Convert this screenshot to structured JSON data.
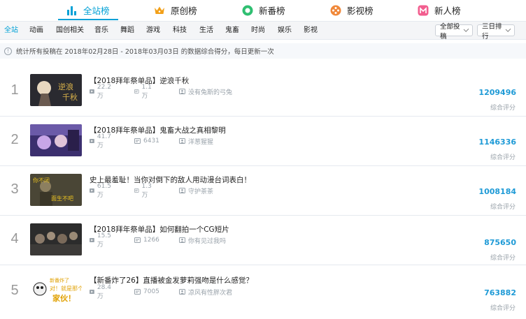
{
  "rank_tabs": [
    {
      "label": "全站榜",
      "icon": "bar-chart-icon",
      "active": true
    },
    {
      "label": "原创榜",
      "icon": "crown-icon",
      "active": false
    },
    {
      "label": "新番榜",
      "icon": "circle-icon",
      "active": false
    },
    {
      "label": "影视榜",
      "icon": "film-reel-icon",
      "active": false
    },
    {
      "label": "新人榜",
      "icon": "new-icon",
      "active": false
    }
  ],
  "categories": [
    "全站",
    "动画",
    "国创相关",
    "音乐",
    "舞蹈",
    "游戏",
    "科技",
    "生活",
    "鬼畜",
    "时尚",
    "娱乐",
    "影视"
  ],
  "filters": {
    "type_select": "全部投稿",
    "period_select": "三日排行"
  },
  "notice": "统计所有投稿在 2018年02月28日 - 2018年03月03日 的数据综合得分，每日更新一次",
  "score_label": "综合评分",
  "items": [
    {
      "rank": "1",
      "title": "【2018拜年祭单品】逆浪千秋",
      "plays": "22.2万",
      "danmaku": "1.1万",
      "uploader": "没有兔斯的弓兔",
      "score": "1209496",
      "thumb_colors": [
        "#2a2a30",
        "#d9b24a"
      ]
    },
    {
      "rank": "2",
      "title": "【2018拜年祭单品】鬼畜大战之真相黎明",
      "plays": "41.7万",
      "danmaku": "6431",
      "uploader": "洋葱猩猩",
      "score": "1146336",
      "thumb_colors": [
        "#3b2f6e",
        "#c8a6e8"
      ]
    },
    {
      "rank": "3",
      "title": "史上最羞耻！当你对倒下的敌人用动漫台词表白！",
      "plays": "61.5万",
      "danmaku": "1.3万",
      "uploader": "守护茶茶",
      "score": "1008184",
      "thumb_colors": [
        "#4a4636",
        "#e8c020"
      ]
    },
    {
      "rank": "4",
      "title": "【2018拜年祭单品】如何翻拍一个CG短片",
      "plays": "15.5万",
      "danmaku": "1266",
      "uploader": "你有见过我吗",
      "score": "875650",
      "thumb_colors": [
        "#2c2c2c",
        "#8a7a6a"
      ]
    },
    {
      "rank": "5",
      "title": "【新番炸了26】直播被金发萝莉强吻是什么感觉？",
      "plays": "28.4万",
      "danmaku": "7005",
      "uploader": "凉风有性胖次君",
      "score": "763882",
      "thumb_colors": [
        "#ffffff",
        "#e0a000"
      ]
    }
  ]
}
